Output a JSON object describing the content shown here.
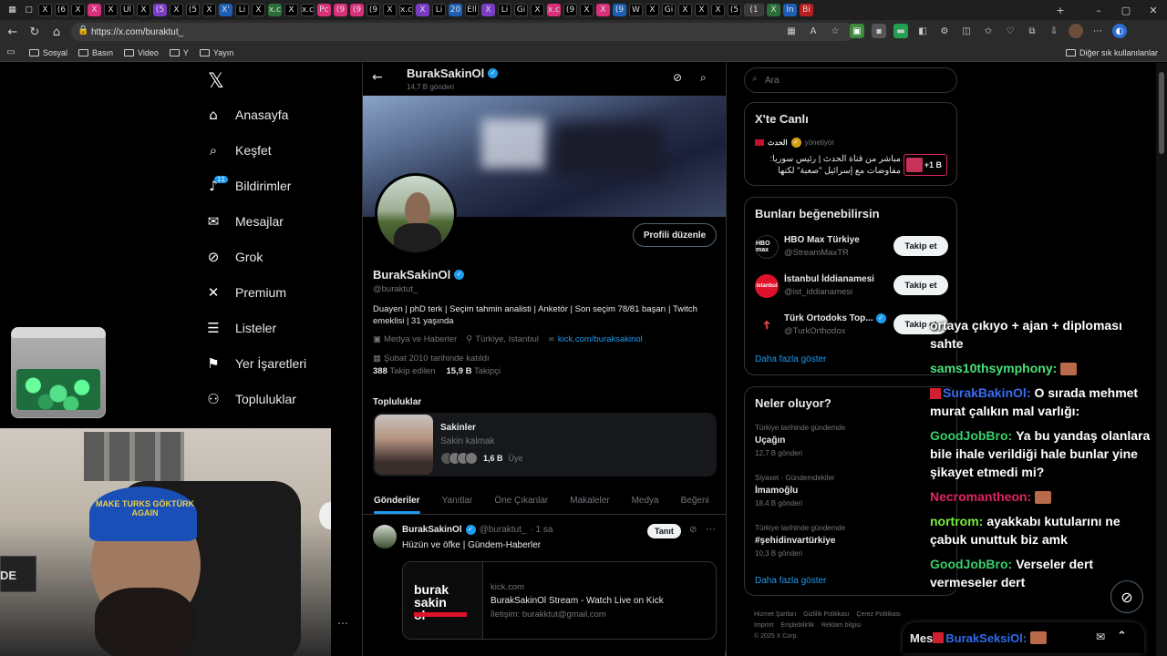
{
  "browser": {
    "url": "https://x.com/buraktut_",
    "bookmarks": [
      "Sosyal",
      "Basın",
      "Video",
      "Y",
      "Yayın"
    ],
    "bookmarks_other": "Diğer sık kullanılanlar",
    "tab_labels": [
      "X",
      "(6",
      "X",
      "X",
      "X",
      "Ul",
      "X",
      "(5",
      "X",
      "(5",
      "X",
      "X'",
      "Li",
      "X",
      "x.c",
      "X",
      "x.c",
      "Pc",
      "(9",
      "(9",
      "(9",
      "X",
      "x.c",
      "X",
      "Li",
      "20",
      "Ell",
      "X",
      "Li",
      "Gi",
      "X",
      "x.c",
      "(9",
      "X",
      "X",
      "(9",
      "W",
      "X",
      "Gi",
      "X",
      "X",
      "X",
      "(5",
      "(1",
      "X",
      "In",
      "Bi"
    ]
  },
  "nav": {
    "items": [
      {
        "label": "Anasayfa",
        "icon": "home-icon"
      },
      {
        "label": "Keşfet",
        "icon": "search-icon"
      },
      {
        "label": "Bildirimler",
        "icon": "bell-icon",
        "badge": "11"
      },
      {
        "label": "Mesajlar",
        "icon": "mail-icon"
      },
      {
        "label": "Grok",
        "icon": "grok-icon"
      },
      {
        "label": "Premium",
        "icon": "x-icon"
      },
      {
        "label": "Listeler",
        "icon": "list-icon"
      },
      {
        "label": "Yer İşaretleri",
        "icon": "bookmark-icon"
      },
      {
        "label": "Topluluklar",
        "icon": "people-icon"
      }
    ]
  },
  "profile": {
    "header_name": "BurakSakinOl",
    "post_count": "14,7 B gönderi",
    "edit_button": "Profili düzenle",
    "name": "BurakSakinOl",
    "handle": "@buraktut_",
    "bio": "Duayen | phD terk | Seçim tahmin analisti | Anketör | Son seçim 78/81 başarı | Twitch emeklisi | 31 yaşında",
    "category": "Medya ve Haberler",
    "location": "Türkiye, Istanbul",
    "link": "kick.com/buraksakinol",
    "joined": "Şubat 2010 tarihinde katıldı",
    "following_count": "388",
    "following_label": "Takip edilen",
    "followers_count": "15,9 B",
    "followers_label": "Takipçi",
    "communities_title": "Topluluklar",
    "community": {
      "name": "Sakinler",
      "sub": "Sakin kalmak",
      "members": "1,6 B",
      "members_label": "Üye"
    },
    "tabs": [
      "Gönderiler",
      "Yanıtlar",
      "Öne Çıkanlar",
      "Makaleler",
      "Medya",
      "Beğeni"
    ],
    "post": {
      "name": "BurakSakinOl",
      "handle": "@buraktut_",
      "time": "· 1 sa",
      "promote": "Tanıt",
      "text": "Hüzün ve öfke | Gündem-Haberler",
      "card": {
        "thumb_line1": "burak",
        "thumb_line2": "sakin",
        "thumb_line3": "ol",
        "domain": "kick.com",
        "title": "BurakSakinOl Stream - Watch Live on Kick",
        "desc": "İletişim: burakktut@gmail.com"
      }
    }
  },
  "right": {
    "search_placeholder": "Ara",
    "live": {
      "title": "X'te Canlı",
      "source": "الحدث",
      "source_role": "yönetiyor",
      "text": "مباشر من قناة الحدث | رئيس سوريا: مفاوضات مع إسرائيل \"صعبة\" لكنها",
      "count": "+1 B"
    },
    "suggestions": {
      "title": "Bunları beğenebilirsin",
      "items": [
        {
          "name": "HBO Max Türkiye",
          "handle": "@StreamMaxTR",
          "avatar": "HBO max",
          "button": "Takip et"
        },
        {
          "name": "İstanbul İddianamesi",
          "handle": "@ist_iddianamesi",
          "avatar": "istanbul",
          "button": "Takip et"
        },
        {
          "name": "Türk Ortodoks Top...",
          "handle": "@TurkOrthodox",
          "avatar": "☦",
          "button": "Takip et"
        }
      ],
      "more": "Daha fazla göster"
    },
    "trends": {
      "title": "Neler oluyor?",
      "items": [
        {
          "meta": "Türkiye tarihinde gündemde",
          "name": "Uçağın",
          "count": "12,7 B gönderi"
        },
        {
          "meta": "Siyaset · Gündemdekiler",
          "name": "İmamoğlu",
          "count": "18,4 B gönderi"
        },
        {
          "meta": "Türkiye tarihinde gündemde",
          "name": "#şehidinvartürkiye",
          "count": "10,3 B gönderi"
        }
      ],
      "more": "Daha fazla göster"
    },
    "footer": [
      "Hizmet Şartları",
      "Gizlilik Politikası",
      "Çerez Politikası",
      "Imprint",
      "Erişilebilirlik",
      "Reklam bilgisi",
      "© 2025 X Corp."
    ]
  },
  "overlay": {
    "cap_text": "MAKE TURKS GÖKTÜRK AGAIN",
    "mic_text": "DE",
    "chat": [
      {
        "user": "",
        "text": "ortaya çıkıyo + ajan + diploması sahte",
        "color": "#ffffff"
      },
      {
        "user": "sams10thsymphony:",
        "text": "",
        "color": "#4ae07a",
        "emote": true
      },
      {
        "user": "SurakBakinOl:",
        "text": "O sırada mehmet murat çalıkın mal varlığı:",
        "color": "#3a6cf0",
        "badge": true
      },
      {
        "user": "GoodJobBro:",
        "text": "Ya bu yandaş olanlara bile ihale verildiği hale bunlar yine şikayet etmedi mi?",
        "color": "#36d06a"
      },
      {
        "user": "Necromantheon:",
        "text": "",
        "color": "#e0245e",
        "emote": true
      },
      {
        "user": "nortrom:",
        "text": "ayakkabı kutularını ne çabuk unuttuk biz amk",
        "color": "#7cf03a"
      },
      {
        "user": "GoodJobBro:",
        "text": "Verseler dert vermeseler dert",
        "color": "#36d06a"
      }
    ],
    "msgbar_label": "Mes",
    "msgbar_user": "BurakSeksiOl:"
  }
}
